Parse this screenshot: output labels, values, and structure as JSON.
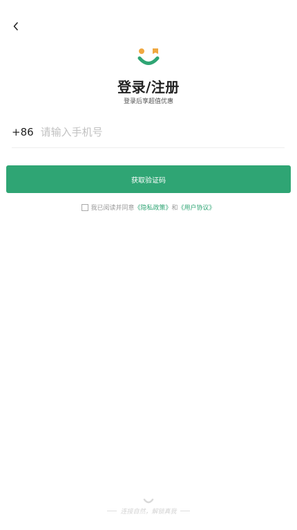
{
  "header": {
    "back_icon": "chevron-left-icon",
    "logo_icon": "smiley-logo-icon"
  },
  "title": "登录/注册",
  "subtitle": "登录后享超值优惠",
  "phone": {
    "prefix": "+86",
    "placeholder": "请输入手机号",
    "value": ""
  },
  "get_code_label": "获取验证码",
  "agreement": {
    "checked": false,
    "prefix": "我已阅读并同意",
    "privacy_link": "《隐私政策》",
    "conjunction": "和",
    "user_link": "《用户协议》"
  },
  "footer": {
    "slogan": "连接自然，解锁真我"
  },
  "colors": {
    "accent": "#2fa574",
    "logo_orange": "#f0a840",
    "text": "#222222",
    "muted": "#999999"
  }
}
